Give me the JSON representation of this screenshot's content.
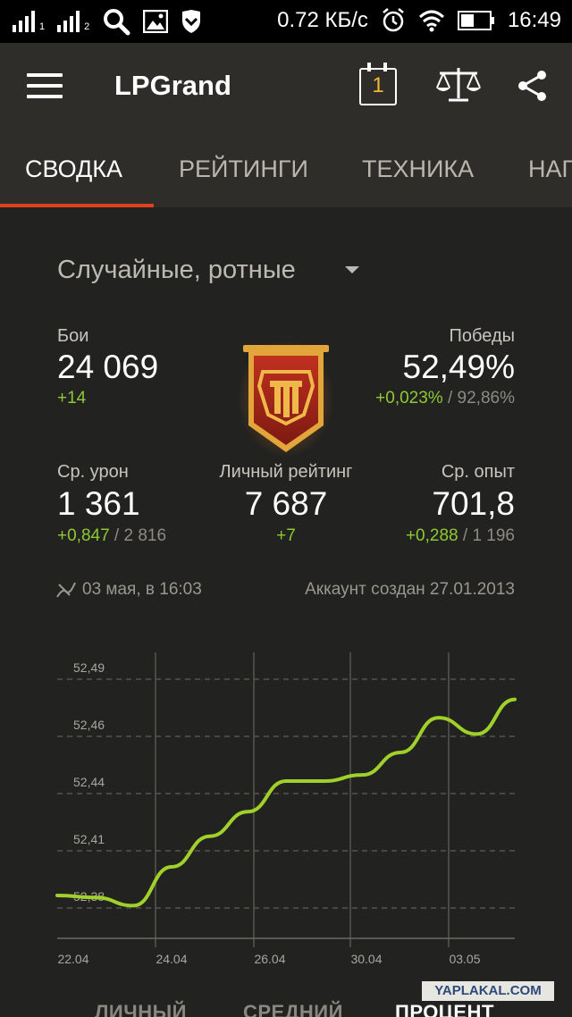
{
  "status_bar": {
    "network_speed": "0.72 КБ/с",
    "time": "16:49",
    "sim1": "1",
    "sim2": "2"
  },
  "app_bar": {
    "title": "LPGrand",
    "calendar_day": "1"
  },
  "tabs": [
    {
      "label": "СВОДКА",
      "active": true
    },
    {
      "label": "РЕЙТИНГИ",
      "active": false
    },
    {
      "label": "ТЕХНИКА",
      "active": false
    },
    {
      "label": "НАГ",
      "active": false
    }
  ],
  "mode_selector": {
    "label": "Случайные, ротные"
  },
  "stats": {
    "battles": {
      "label": "Бои",
      "value": "24 069",
      "delta": "+14"
    },
    "wins": {
      "label": "Победы",
      "value": "52,49%",
      "delta": "+0,023%",
      "separator": " / ",
      "sub": "92,86%"
    },
    "avg_damage": {
      "label": "Ср. урон",
      "value": "1 361",
      "delta": "+0,847",
      "separator": " / ",
      "sub": "2 816"
    },
    "personal_rating": {
      "label": "Личный рейтинг",
      "value": "7 687",
      "delta": "+7"
    },
    "avg_exp": {
      "label": "Ср. опыт",
      "value": "701,8",
      "delta": "+0,288",
      "separator": " / ",
      "sub": "1 196"
    }
  },
  "meta": {
    "last_battle": "03 мая, в 16:03",
    "account_created": "Аккаунт создан 27.01.2013"
  },
  "colors": {
    "accent": "#e0421f",
    "positive": "#8fc934",
    "line": "#9fd12a",
    "badge_red": "#a8241a",
    "badge_gold": "#e2a53a"
  },
  "chart_data": {
    "type": "line",
    "x": [
      "22.04",
      "23.04",
      "24.04",
      "25.04",
      "26.04",
      "27.04",
      "28.04",
      "29.04",
      "30.04",
      "01.05",
      "02.05",
      "03.05",
      "04.05"
    ],
    "y_ticks": [
      "52,49",
      "52,46",
      "52,44",
      "52,41",
      "52,38"
    ],
    "x_ticks": [
      "22.04",
      "24.04",
      "26.04",
      "30.04",
      "03.05"
    ],
    "series": [
      {
        "values": [
          52.381,
          52.38,
          52.376,
          52.395,
          52.41,
          52.422,
          52.437,
          52.437,
          52.44,
          52.451,
          52.468,
          52.46,
          52.477
        ]
      }
    ],
    "ylim": [
      52.36,
      52.5
    ],
    "grid": true
  }
}
